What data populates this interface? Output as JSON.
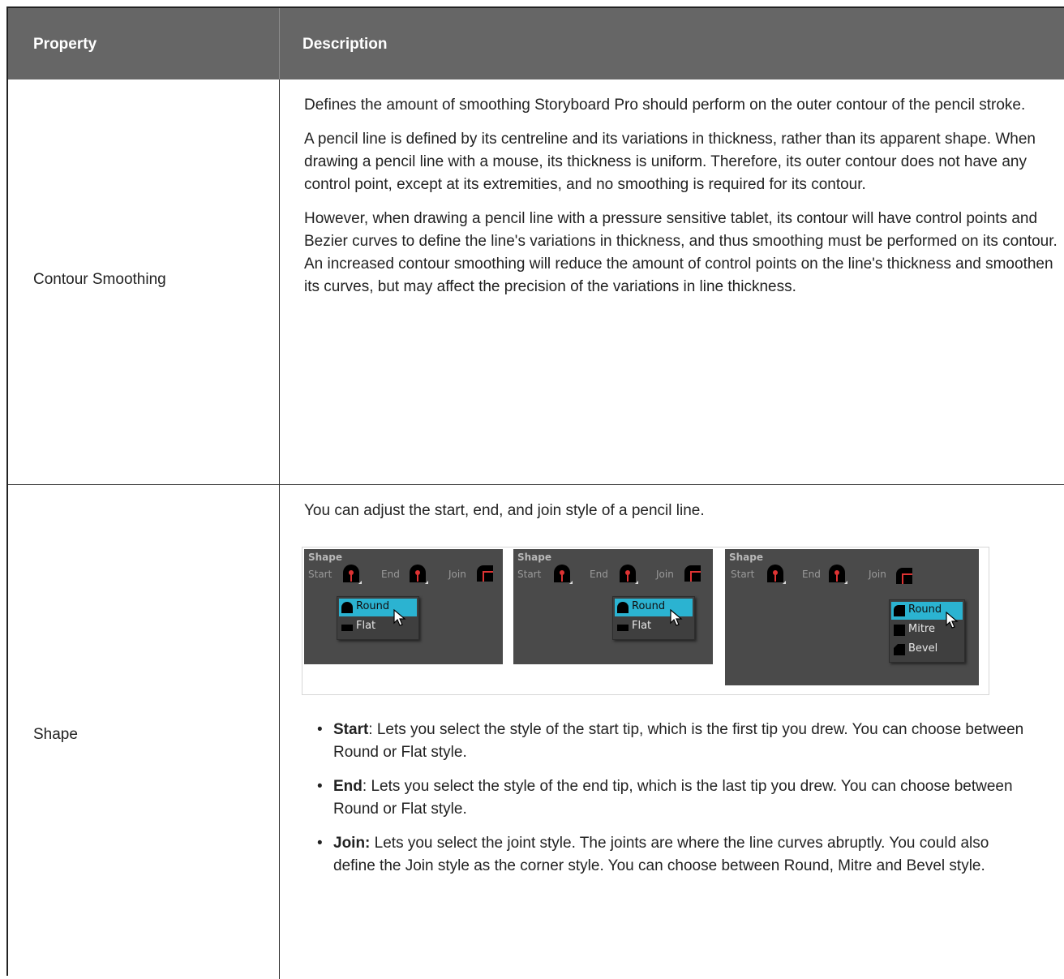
{
  "header": {
    "property": "Property",
    "description": "Description"
  },
  "rows": [
    {
      "property": "Contour Smoothing",
      "paragraphs": [
        "Defines the amount of smoothing Storyboard Pro should perform on the outer contour of the pencil stroke.",
        "A pencil line is defined by its centreline and its variations in thickness, rather than its apparent shape. When drawing a pencil line with a mouse, its thickness is uniform. Therefore, its outer contour does not have any control point, except at its extremities, and no smoothing is required for its contour.",
        "However, when drawing a pencil line with a pressure sensitive tablet, its contour will have control points and Bezier curves to define the line's variations in thickness, and thus smoothing must be performed on its contour. An increased contour smoothing will reduce the amount of control points on the line's thickness and smoothen its curves, but may affect the precision of the variations in line thickness."
      ]
    },
    {
      "property": "Shape",
      "intro": "You can adjust the start, end, and join style of a pencil line.",
      "bullets": [
        {
          "term": "Start",
          "sep": ":",
          "text": " Lets you select the style of the start tip, which is the first tip you drew. You can choose between Round or Flat style."
        },
        {
          "term": "End",
          "sep": ":",
          "text": " Lets you select the style of the end tip, which is the last tip you drew. You can choose between Round or Flat style."
        },
        {
          "term": "Join:",
          "sep": "",
          "text": " Lets you select the joint style. The joints are where the line curves abruptly. You could also define the Join style as the corner style. You can choose between Round, Mitre and Bevel style."
        }
      ]
    }
  ],
  "screenshots": {
    "panel_title": "Shape",
    "start_label": "Start",
    "end_label": "End",
    "join_label": "Join",
    "tip_menu": [
      "Round",
      "Flat"
    ],
    "join_menu": [
      "Round",
      "Mitre",
      "Bevel"
    ],
    "highlight_color": "#2bb3d1",
    "panel_color": "#4a4a4a"
  }
}
